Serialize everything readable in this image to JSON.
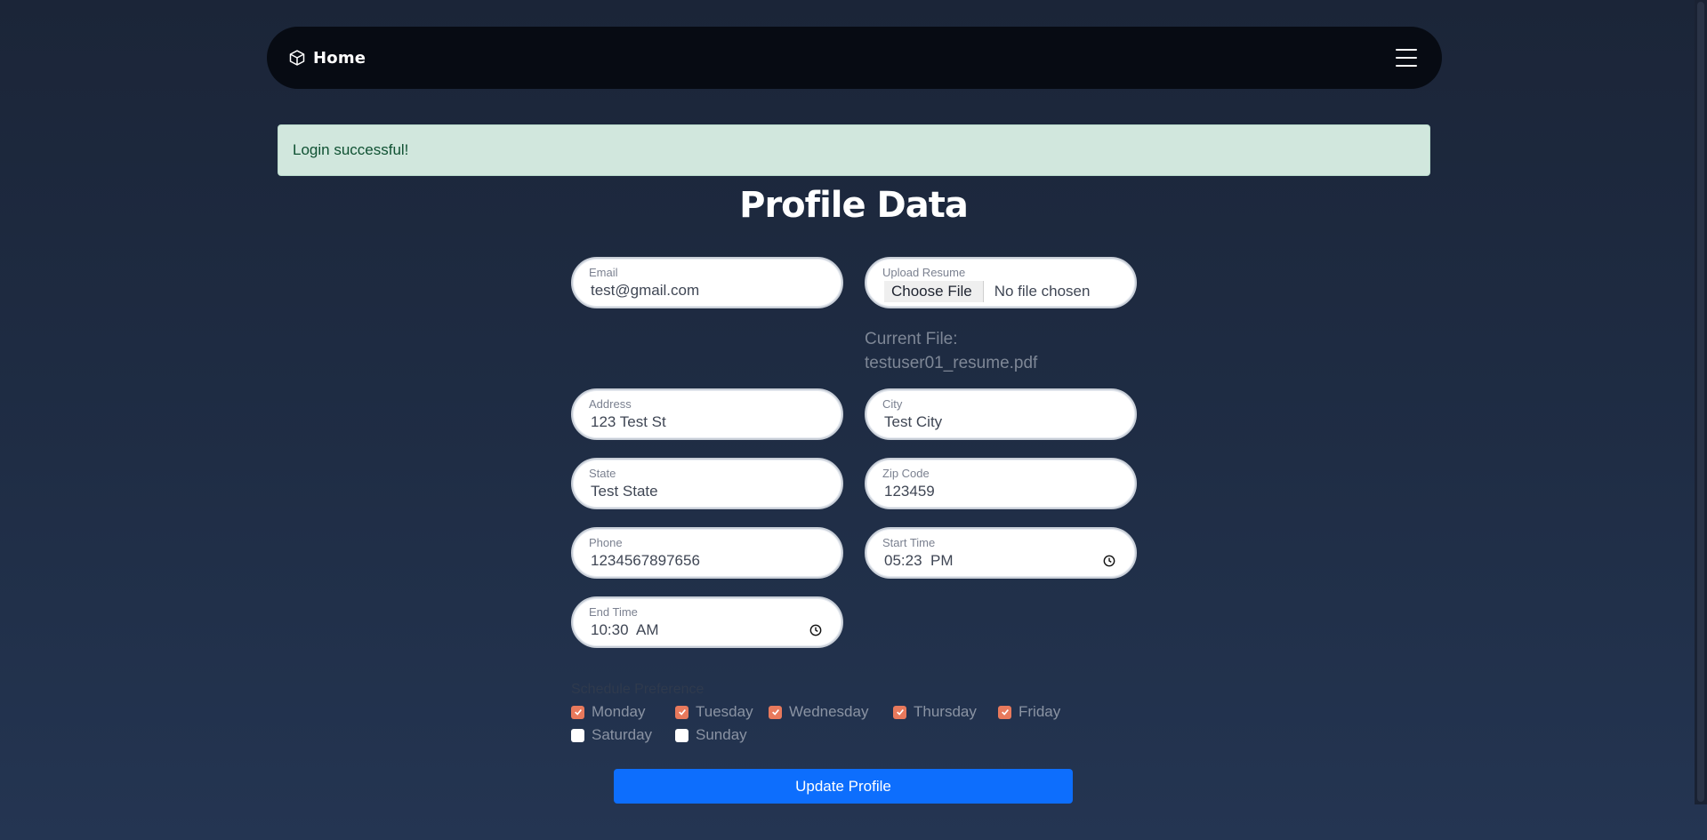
{
  "navbar": {
    "brand_label": "Home",
    "brand_icon": "cube-icon",
    "menu_icon": "hamburger-menu-icon"
  },
  "alert": {
    "message": "Login successful!",
    "bg_color": "#d1e7dd",
    "text_color": "#0f5132"
  },
  "page": {
    "title": "Profile Data"
  },
  "form": {
    "email": {
      "label": "Email",
      "value": "test@gmail.com"
    },
    "resume": {
      "label": "Upload Resume",
      "button_label": "Choose File",
      "status": "No file chosen",
      "current_file_label": "Current File:",
      "current_file_name": "testuser01_resume.pdf"
    },
    "address": {
      "label": "Address",
      "value": "123 Test St"
    },
    "city": {
      "label": "City",
      "value": "Test City"
    },
    "state": {
      "label": "State",
      "value": "Test State"
    },
    "zip": {
      "label": "Zip Code",
      "value": "123459"
    },
    "phone": {
      "label": "Phone",
      "value": "1234567897656"
    },
    "start_time": {
      "label": "Start Time",
      "value": "05:23  PM"
    },
    "end_time": {
      "label": "End Time",
      "value": "10:30  AM"
    },
    "schedule": {
      "label": "Schedule Preference",
      "days": [
        {
          "label": "Monday",
          "checked": true
        },
        {
          "label": "Tuesday",
          "checked": true
        },
        {
          "label": "Wednesday",
          "checked": true
        },
        {
          "label": "Thursday",
          "checked": true
        },
        {
          "label": "Friday",
          "checked": true
        },
        {
          "label": "Saturday",
          "checked": false
        },
        {
          "label": "Sunday",
          "checked": false
        }
      ],
      "check_color": "#e8795c"
    },
    "submit_label": "Update Profile",
    "submit_color": "#0d6efd"
  }
}
